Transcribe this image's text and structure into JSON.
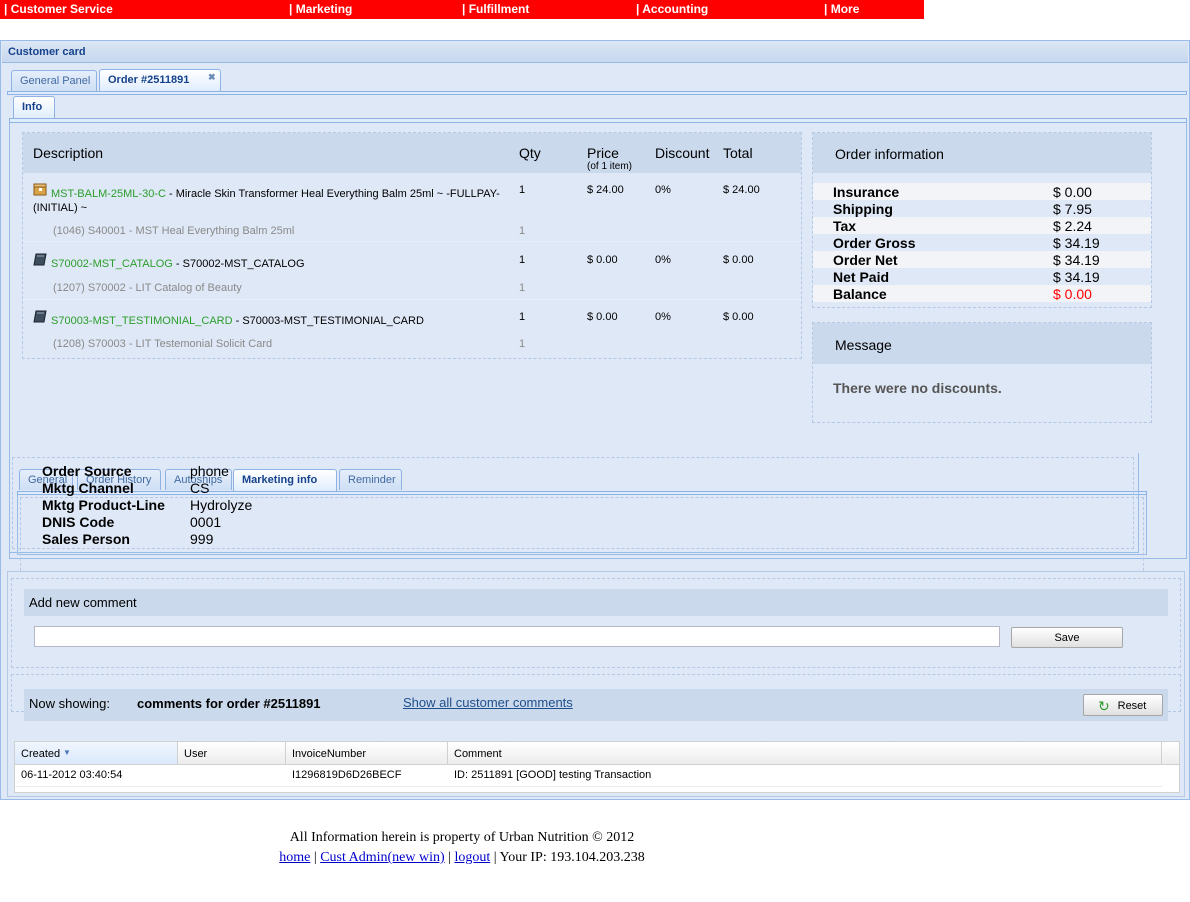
{
  "nav": {
    "items": [
      {
        "label": "| Customer Service"
      },
      {
        "label": "| Marketing"
      },
      {
        "label": "| Fulfillment"
      },
      {
        "label": "| Accounting"
      },
      {
        "label": "| More"
      }
    ]
  },
  "card": {
    "title": "Customer card",
    "tabs": [
      {
        "label": "General Panel"
      },
      {
        "label": "Order #2511891"
      }
    ],
    "subtab": "Info"
  },
  "items_table": {
    "headers": {
      "description": "Description",
      "qty": "Qty",
      "price": "Price",
      "price_sub": "(of 1 item)",
      "discount": "Discount",
      "total": "Total"
    },
    "rows": [
      {
        "sku": "MST-BALM-25ML-30-C",
        "desc": " - Miracle Skin Transformer Heal Everything Balm 25ml ~ -FULLPAY-",
        "desc2": "(INITIAL) ~",
        "qty": "1",
        "price": "$ 24.00",
        "discount": "0%",
        "total": "$ 24.00",
        "sub": "(1046) S40001 - MST Heal Everything Balm 25ml",
        "sub_qty": "1",
        "icon": "package-icon"
      },
      {
        "sku": "S70002-MST_CATALOG",
        "desc": " - S70002-MST_CATALOG",
        "desc2": "",
        "qty": "1",
        "price": "$ 0.00",
        "discount": "0%",
        "total": "$ 0.00",
        "sub": "(1207) S70002 - LIT Catalog of Beauty",
        "sub_qty": "1",
        "icon": "book-icon"
      },
      {
        "sku": "S70003-MST_TESTIMONIAL_CARD",
        "desc": " - S70003-MST_TESTIMONIAL_CARD",
        "desc2": "",
        "qty": "1",
        "price": "$ 0.00",
        "discount": "0%",
        "total": "$ 0.00",
        "sub": "(1208) S70003 - LIT Testemonial Solicit Card",
        "sub_qty": "1",
        "icon": "book-icon"
      }
    ]
  },
  "order_info": {
    "title": "Order information",
    "rows": [
      {
        "label": "Insurance",
        "value": "$ 0.00"
      },
      {
        "label": "Shipping",
        "value": "$ 7.95"
      },
      {
        "label": "Tax",
        "value": "$ 2.24"
      },
      {
        "label": "Order Gross",
        "value": "$ 34.19"
      },
      {
        "label": "Order Net",
        "value": "$ 34.19"
      },
      {
        "label": "Net Paid",
        "value": "$ 34.19"
      },
      {
        "label": "Balance",
        "value": "$ 0.00"
      }
    ],
    "balance_color": "#ff0000"
  },
  "message": {
    "title": "Message",
    "text": "There were no discounts."
  },
  "bottom_tabs": [
    {
      "label": "General"
    },
    {
      "label": "Order History"
    },
    {
      "label": "Autoships"
    },
    {
      "label": "Marketing info"
    },
    {
      "label": "Reminder"
    }
  ],
  "marketing": {
    "rows": [
      {
        "label": "Order Source",
        "value": "phone"
      },
      {
        "label": "Mktg Channel",
        "value": "CS"
      },
      {
        "label": "Mktg Product-Line",
        "value": "Hydrolyze"
      },
      {
        "label": "DNIS Code",
        "value": "0001"
      },
      {
        "label": "Sales Person",
        "value": "999"
      }
    ]
  },
  "comments": {
    "add_title": "Add new comment",
    "input_value": "",
    "save_label": "Save",
    "now_showing_label": "Now showing:",
    "now_showing_value": "comments for order #2511891",
    "show_all_link": "Show all customer comments",
    "reset_label": "Reset",
    "grid": {
      "headers": [
        "Created",
        "User",
        "InvoiceNumber",
        "Comment"
      ],
      "rows": [
        [
          "06-11-2012 03:40:54",
          "",
          "I1296819D6D26BECF",
          "ID: 2511891 [GOOD] testing Transaction"
        ]
      ]
    }
  },
  "footer": {
    "line1": "All Information herein is property of Urban Nutrition © 2012",
    "home": "home",
    "sep1": " | ",
    "cust_admin": "Cust Admin(new win)",
    "sep2": " | ",
    "logout": "logout",
    "ip_text": " | Your IP: 193.104.203.238"
  },
  "colors": {
    "nav_bg": "#ff0000",
    "sku_green": "#2a9e2a",
    "panel_blue": "#dfe8f6"
  }
}
